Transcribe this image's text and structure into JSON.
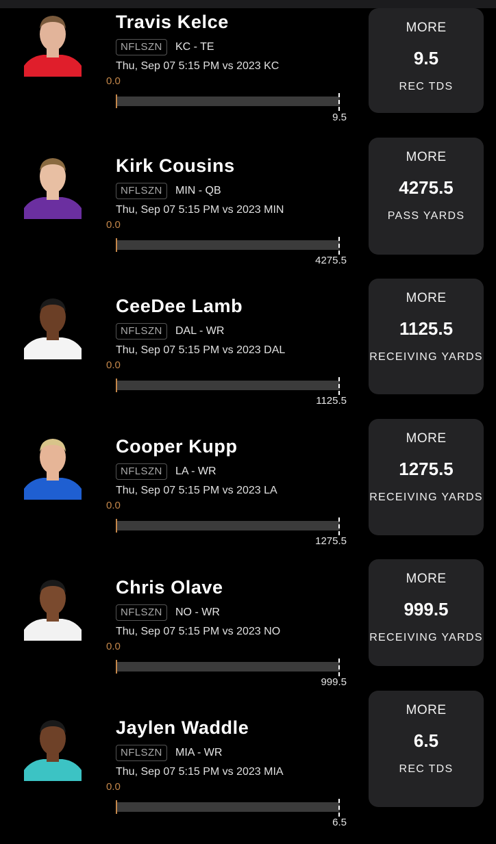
{
  "players": [
    {
      "name": "Travis Kelce",
      "badge": "NFLSZN",
      "team": "KC - TE",
      "date": "Thu, Sep 07 5:15 PM  vs 2023 KC",
      "min": "0.0",
      "max": "9.5",
      "choice": "MORE",
      "value": "9.5",
      "stat": "REC TDS",
      "jersey": "#e01e2b",
      "skin": "#e2b49a",
      "hair": "#7a5a3c"
    },
    {
      "name": "Kirk Cousins",
      "badge": "NFLSZN",
      "team": "MIN - QB",
      "date": "Thu, Sep 07 5:15 PM  vs 2023 MIN",
      "min": "0.0",
      "max": "4275.5",
      "choice": "MORE",
      "value": "4275.5",
      "stat": "PASS YARDS",
      "jersey": "#6b2fa0",
      "skin": "#e8bfa3",
      "hair": "#8a6a40"
    },
    {
      "name": "CeeDee Lamb",
      "badge": "NFLSZN",
      "team": "DAL - WR",
      "date": "Thu, Sep 07 5:15 PM  vs 2023 DAL",
      "min": "0.0",
      "max": "1125.5",
      "choice": "MORE",
      "value": "1125.5",
      "stat": "RECEIVING YARDS",
      "jersey": "#f4f4f4",
      "skin": "#6b3f26",
      "hair": "#1a1a1a"
    },
    {
      "name": "Cooper Kupp",
      "badge": "NFLSZN",
      "team": "LA - WR",
      "date": "Thu, Sep 07 5:15 PM  vs 2023 LA",
      "min": "0.0",
      "max": "1275.5",
      "choice": "MORE",
      "value": "1275.5",
      "stat": "RECEIVING YARDS",
      "jersey": "#1f5fd1",
      "skin": "#e6b597",
      "hair": "#d8c48a"
    },
    {
      "name": "Chris Olave",
      "badge": "NFLSZN",
      "team": "NO - WR",
      "date": "Thu, Sep 07 5:15 PM  vs 2023 NO",
      "min": "0.0",
      "max": "999.5",
      "choice": "MORE",
      "value": "999.5",
      "stat": "RECEIVING YARDS",
      "jersey": "#f2f2f2",
      "skin": "#7a4a2e",
      "hair": "#1a1a1a"
    },
    {
      "name": "Jaylen Waddle",
      "badge": "NFLSZN",
      "team": "MIA - WR",
      "date": "Thu, Sep 07 5:15 PM  vs 2023 MIA",
      "min": "0.0",
      "max": "6.5",
      "choice": "MORE",
      "value": "6.5",
      "stat": "REC TDS",
      "jersey": "#3cc3c4",
      "skin": "#6e4128",
      "hair": "#1a1a1a"
    }
  ]
}
